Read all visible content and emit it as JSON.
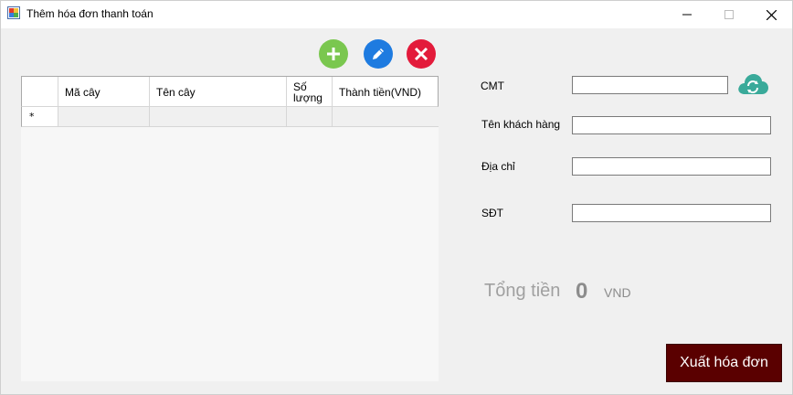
{
  "window": {
    "title": "Thêm hóa đơn thanh toán",
    "minimize_glyph": "—",
    "maximize_glyph": "☐",
    "close_glyph": "✕"
  },
  "toolbar": {
    "add_icon": "plus-icon",
    "edit_icon": "pencil-icon",
    "delete_icon": "x-icon",
    "add_color": "#7ac74f",
    "edit_color": "#1e7be0",
    "delete_color": "#e31b3b"
  },
  "grid": {
    "columns": [
      "",
      "Mã cây",
      "Tên cây",
      "Số lượng",
      "Thành tiền(VND)"
    ],
    "column_line1": "Số",
    "column_line2": "lượng",
    "new_row_marker": "*"
  },
  "form": {
    "cmt_label": "CMT",
    "cmt_value": "",
    "name_label": "Tên khách hàng",
    "name_value": "",
    "address_label": "Địa chỉ",
    "address_value": "",
    "phone_label": "SĐT",
    "phone_value": "",
    "refresh_icon": "cloud-refresh-icon"
  },
  "total": {
    "label": "Tổng tiền",
    "value": "0",
    "unit": "VND"
  },
  "actions": {
    "export_label": "Xuất hóa đơn",
    "export_color": "#5a0000"
  }
}
